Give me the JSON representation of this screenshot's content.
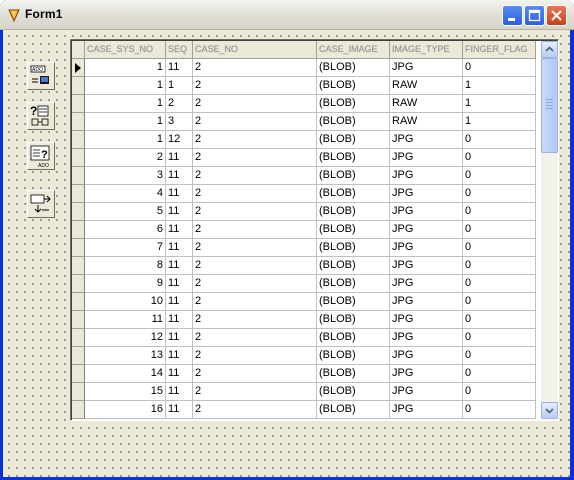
{
  "window": {
    "title": "Form1"
  },
  "titlebar_buttons": {
    "minimize": "minimize-icon",
    "maximize": "maximize-icon",
    "close": "close-icon"
  },
  "components": [
    {
      "name": "ado-connection-icon"
    },
    {
      "name": "query-icon"
    },
    {
      "name": "ado-dataset-icon"
    },
    {
      "name": "datasource-icon"
    }
  ],
  "grid": {
    "columns": [
      "CASE_SYS_NO",
      "SEQ",
      "CASE_NO",
      "CASE_IMAGE",
      "IMAGE_TYPE",
      "FINGER_FLAG"
    ],
    "rows": [
      [
        "1",
        "11",
        "2",
        "(BLOB)",
        "JPG",
        "0"
      ],
      [
        "1",
        "1",
        "2",
        "(BLOB)",
        "RAW",
        "1"
      ],
      [
        "1",
        "2",
        "2",
        "(BLOB)",
        "RAW",
        "1"
      ],
      [
        "1",
        "3",
        "2",
        "(BLOB)",
        "RAW",
        "1"
      ],
      [
        "1",
        "12",
        "2",
        "(BLOB)",
        "JPG",
        "0"
      ],
      [
        "2",
        "11",
        "2",
        "(BLOB)",
        "JPG",
        "0"
      ],
      [
        "3",
        "11",
        "2",
        "(BLOB)",
        "JPG",
        "0"
      ],
      [
        "4",
        "11",
        "2",
        "(BLOB)",
        "JPG",
        "0"
      ],
      [
        "5",
        "11",
        "2",
        "(BLOB)",
        "JPG",
        "0"
      ],
      [
        "6",
        "11",
        "2",
        "(BLOB)",
        "JPG",
        "0"
      ],
      [
        "7",
        "11",
        "2",
        "(BLOB)",
        "JPG",
        "0"
      ],
      [
        "8",
        "11",
        "2",
        "(BLOB)",
        "JPG",
        "0"
      ],
      [
        "9",
        "11",
        "2",
        "(BLOB)",
        "JPG",
        "0"
      ],
      [
        "10",
        "11",
        "2",
        "(BLOB)",
        "JPG",
        "0"
      ],
      [
        "11",
        "11",
        "2",
        "(BLOB)",
        "JPG",
        "0"
      ],
      [
        "12",
        "11",
        "2",
        "(BLOB)",
        "JPG",
        "0"
      ],
      [
        "13",
        "11",
        "2",
        "(BLOB)",
        "JPG",
        "0"
      ],
      [
        "14",
        "11",
        "2",
        "(BLOB)",
        "JPG",
        "0"
      ],
      [
        "15",
        "11",
        "2",
        "(BLOB)",
        "JPG",
        "0"
      ],
      [
        "16",
        "11",
        "2",
        "(BLOB)",
        "JPG",
        "0"
      ]
    ],
    "active_row": 0
  },
  "colors": {
    "form_bg": "#ece9d8",
    "title_text": "#000000",
    "close_btn": "#c6401c",
    "scroll_accent": "#98b1e6"
  }
}
